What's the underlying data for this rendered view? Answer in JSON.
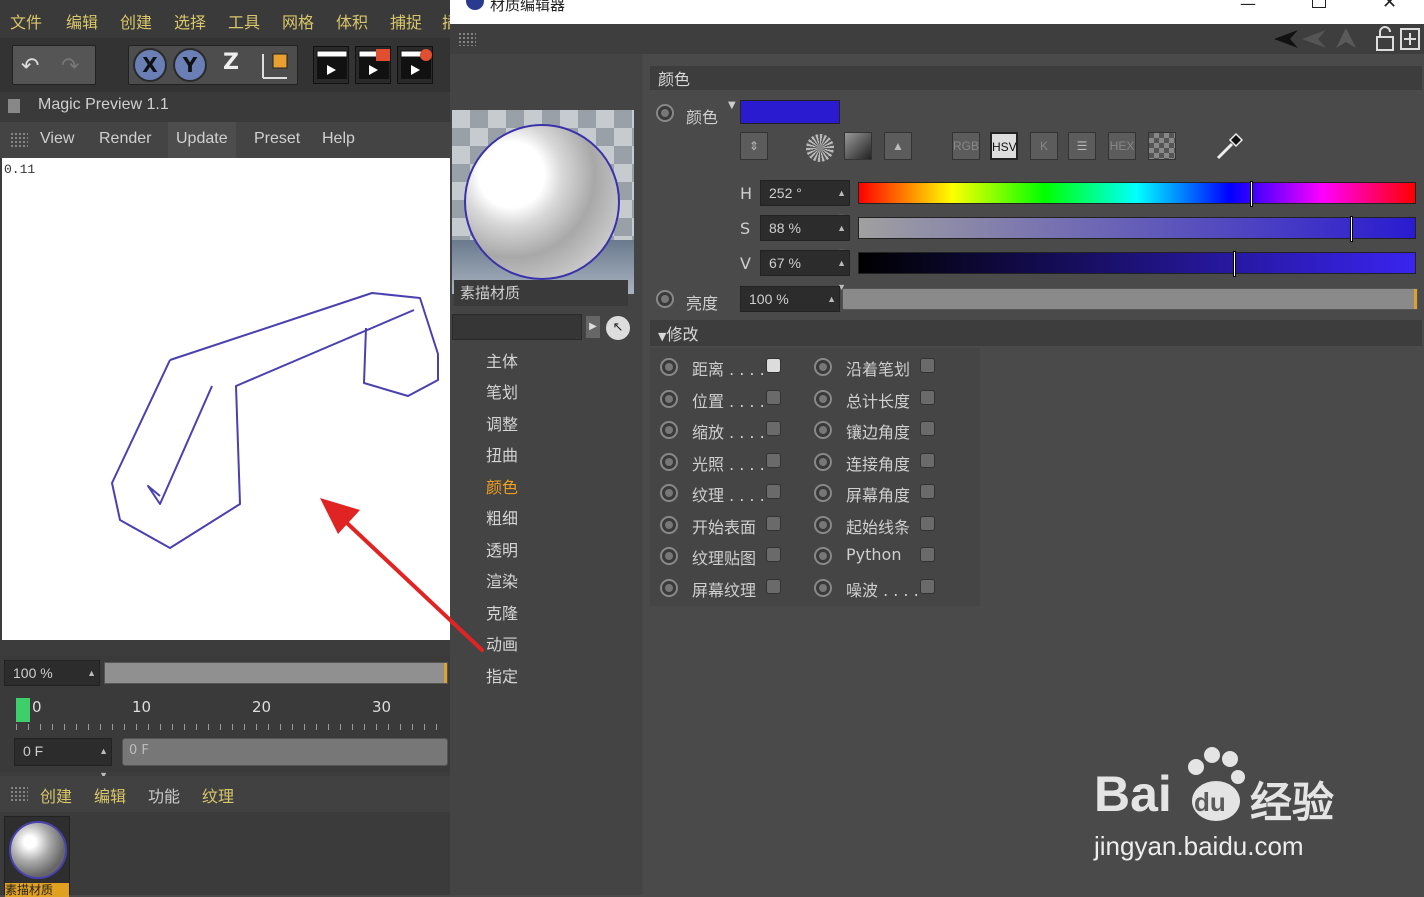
{
  "main_window": {
    "menubar": [
      "文件",
      "编辑",
      "创建",
      "选择",
      "工具",
      "网格",
      "体积",
      "捕捉",
      "插"
    ],
    "toolbar": {
      "axis_x": "X",
      "axis_y": "Y",
      "axis_z": "Z",
      "icons": [
        "undo-icon",
        "redo-icon",
        "coordinate-system-icon",
        "render-view-icon",
        "render-picture-queue-icon",
        "render-settings-icon"
      ]
    },
    "magic_preview": {
      "title": "Magic Preview 1.1",
      "menu": [
        "View",
        "Render",
        "Update",
        "Preset",
        "Help"
      ],
      "time_readout": "0.11",
      "stroke_color": "#4a40b0"
    },
    "zoom": {
      "value": "100 %"
    },
    "timeline": {
      "ticks": [
        "0",
        "10",
        "20",
        "30"
      ],
      "current_frame": 0
    },
    "frame_field": {
      "value": "0 F",
      "scrub_label": "0 F"
    },
    "material_manager": {
      "menu": [
        "创建",
        "编辑",
        "功能",
        "纹理"
      ],
      "material_name": "素描材质"
    }
  },
  "material_editor": {
    "title": "材质编辑器",
    "window_controls": [
      "minimize-icon",
      "maximize-icon",
      "close-icon"
    ],
    "material_name": "素描材质",
    "channels": [
      "主体",
      "笔划",
      "调整",
      "扭曲",
      "颜色",
      "粗细",
      "透明",
      "渲染",
      "克隆",
      "动画",
      "指定"
    ],
    "active_channel": "颜色",
    "color_section": {
      "header": "颜色",
      "color_label": "颜色",
      "swatch_color": "#2a1bd0",
      "mode_buttons": [
        "RGB",
        "HSV",
        "K",
        "HEX"
      ],
      "active_mode": "HSV",
      "h": {
        "label": "H",
        "value": "252 °",
        "fraction": 0.7
      },
      "s": {
        "label": "S",
        "value": "88 %",
        "fraction": 0.88
      },
      "v": {
        "label": "V",
        "value": "67 %",
        "fraction": 0.67
      },
      "brightness": {
        "label": "亮度",
        "value": "100 %",
        "fraction": 1.0
      }
    },
    "modify_section": {
      "header": "修改",
      "left_items": [
        "距离 . . . .",
        "位置 . . . .",
        "缩放 . . . .",
        "光照 . . . .",
        "纹理 . . . .",
        "开始表面",
        "纹理贴图",
        "屏幕纹理"
      ],
      "right_items": [
        "沿着笔划",
        "总计长度",
        "镶边角度",
        "连接角度",
        "屏幕角度",
        "起始线条",
        "Python",
        "噪波 . . . ."
      ]
    }
  },
  "watermark": {
    "brand_latin": "Bai",
    "brand_du": "du",
    "brand_cn": "经验",
    "url": "jingyan.baidu.com"
  },
  "annotation": {
    "arrow_color": "#e02424"
  }
}
